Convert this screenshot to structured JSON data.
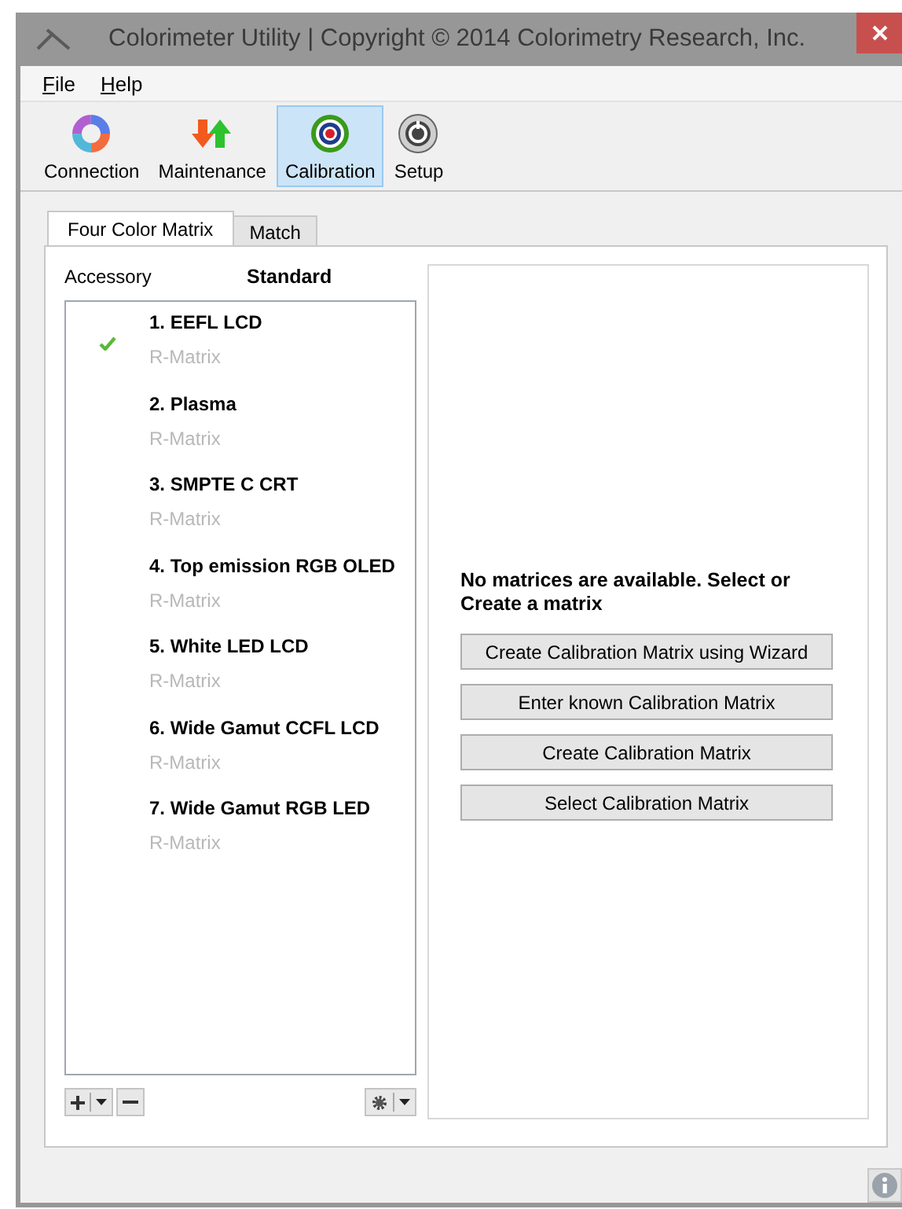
{
  "window": {
    "title": "Colorimeter Utility | Copyright © 2014 Colorimetry Research, Inc."
  },
  "menu": [
    {
      "label": "File"
    },
    {
      "label": "Help"
    }
  ],
  "toolbar": [
    {
      "label": "Connection",
      "kind": "connection",
      "selected": false
    },
    {
      "label": "Maintenance",
      "kind": "maintenance",
      "selected": false
    },
    {
      "label": "Calibration",
      "kind": "calibration",
      "selected": true
    },
    {
      "label": "Setup",
      "kind": "setup",
      "selected": false
    }
  ],
  "tabs": [
    {
      "label": "Four Color Matrix",
      "selected": true
    },
    {
      "label": "Match",
      "selected": false
    }
  ],
  "accessory": {
    "label": "Accessory",
    "value": "Standard"
  },
  "matrices": [
    {
      "name": "1. EEFL LCD",
      "type": "R-Matrix",
      "checked": true
    },
    {
      "name": "2. Plasma",
      "type": "R-Matrix",
      "checked": false
    },
    {
      "name": "3. SMPTE C CRT",
      "type": "R-Matrix",
      "checked": false
    },
    {
      "name": "4. Top emission RGB OLED",
      "type": "R-Matrix",
      "checked": false
    },
    {
      "name": "5. White LED LCD",
      "type": "R-Matrix",
      "checked": false
    },
    {
      "name": "6. Wide Gamut CCFL LCD",
      "type": "R-Matrix",
      "checked": false
    },
    {
      "name": "7. Wide Gamut RGB LED",
      "type": "R-Matrix",
      "checked": false
    }
  ],
  "message": "No matrices are available. Select or Create a matrix",
  "actions": [
    "Create Calibration Matrix using Wizard",
    "Enter known Calibration Matrix",
    "Create Calibration Matrix",
    "Select Calibration Matrix"
  ]
}
